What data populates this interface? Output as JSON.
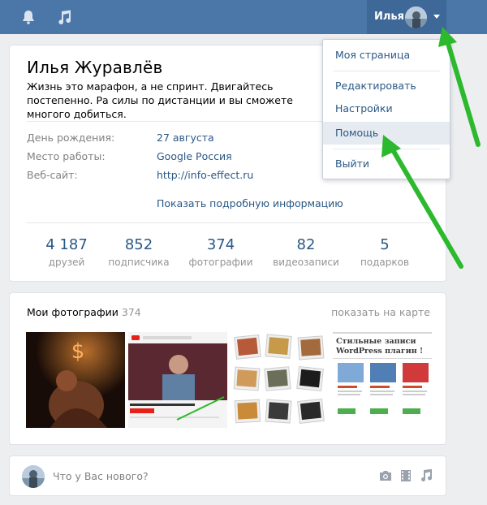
{
  "header": {
    "user_name": "Илья",
    "icons": [
      "bell-icon",
      "music-note-icon",
      "chevron-down-icon"
    ],
    "bg_color": "#4a76a8"
  },
  "menu": {
    "items": [
      {
        "label": "Моя страница"
      },
      {
        "label": "Редактировать"
      },
      {
        "label": "Настройки"
      },
      {
        "label": "Помощь",
        "highlighted": true
      },
      {
        "label": "Выйти"
      }
    ]
  },
  "profile": {
    "name": "Илья Журавлёв",
    "status": "Жизнь это марафон, а не спринт. Двигайтесь постепенно. Ра силы по дистанции и вы сможете многого добиться.",
    "info": [
      {
        "label": "День рождения:",
        "value": "27 августа"
      },
      {
        "label": "Место работы:",
        "value": "Google Россия"
      },
      {
        "label": "Веб-сайт:",
        "value": "http://info-effect.ru"
      }
    ],
    "more_link": "Показать подробную информацию",
    "counters": [
      {
        "num": "4 187",
        "label": "друзей"
      },
      {
        "num": "852",
        "label": "подписчика"
      },
      {
        "num": "374",
        "label": "фотографии"
      },
      {
        "num": "82",
        "label": "видеозаписи"
      },
      {
        "num": "5",
        "label": "подарков"
      }
    ]
  },
  "photos": {
    "title": "Мои фотографии",
    "count": "374",
    "map_link": "показать на карте",
    "blog_heading_1": "Стильные записи",
    "blog_heading_2": "WordPress плагин !"
  },
  "post": {
    "placeholder": "Что у Вас нового?",
    "icons": [
      "camera-icon",
      "video-icon",
      "music-note-icon"
    ]
  },
  "colors": {
    "link": "#2a5885",
    "accent_arrow": "#2db92d",
    "muted": "#939393"
  }
}
